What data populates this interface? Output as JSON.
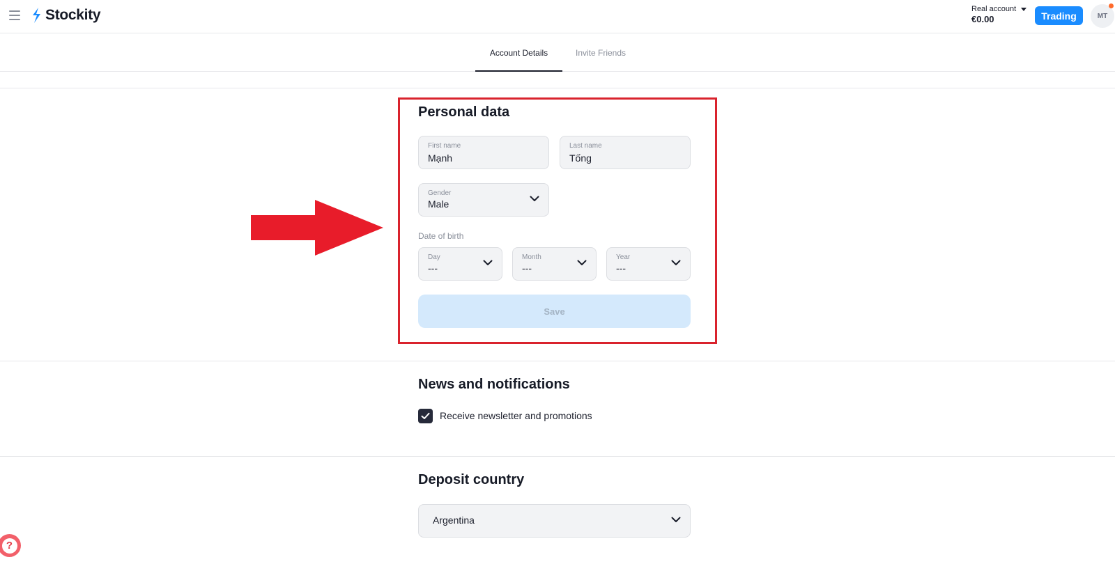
{
  "app": {
    "name": "Stockity"
  },
  "header": {
    "account_type": "Real account",
    "balance": "€0.00",
    "trading_button": "Trading",
    "avatar_initials": "MT"
  },
  "tabs": [
    {
      "label": "Account Details",
      "active": true
    },
    {
      "label": "Invite Friends",
      "active": false
    }
  ],
  "personal_data": {
    "title": "Personal data",
    "first_name": {
      "label": "First name",
      "value": "Mạnh"
    },
    "last_name": {
      "label": "Last name",
      "value": "Tống"
    },
    "gender": {
      "label": "Gender",
      "value": "Male"
    },
    "date_of_birth": {
      "label": "Date of birth",
      "day": {
        "label": "Day",
        "value": "---"
      },
      "month": {
        "label": "Month",
        "value": "---"
      },
      "year": {
        "label": "Year",
        "value": "---"
      }
    },
    "save_button": "Save"
  },
  "news": {
    "title": "News and notifications",
    "newsletter_label": "Receive newsletter and promotions",
    "newsletter_checked": true
  },
  "deposit": {
    "title": "Deposit country",
    "country": "Argentina"
  },
  "annotations": {
    "highlight_color": "#d9232d",
    "arrow_color": "#e81c2a"
  },
  "icons": {
    "menu": "hamburger-icon",
    "chevron": "chevron-down-icon",
    "check": "check-icon",
    "help": "question-icon"
  }
}
